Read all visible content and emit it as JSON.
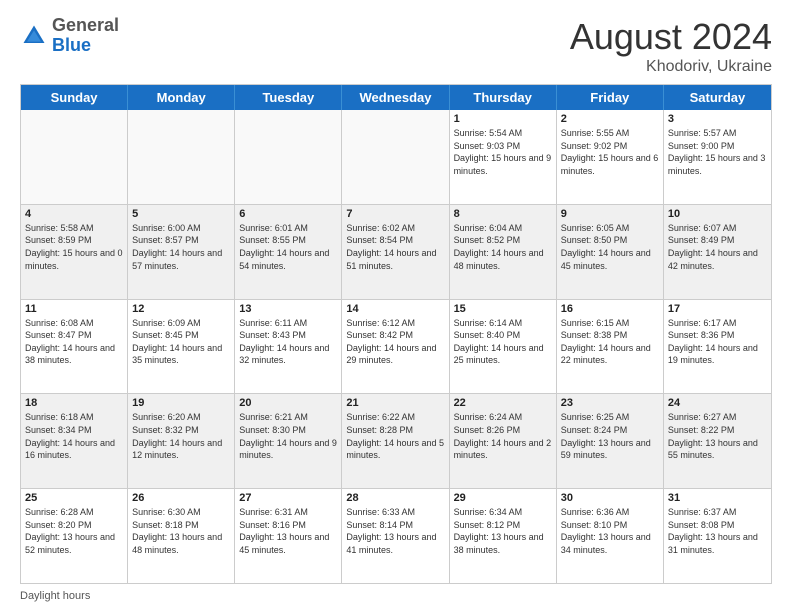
{
  "header": {
    "logo": {
      "general": "General",
      "blue": "Blue"
    },
    "month_year": "August 2024",
    "location": "Khodoriv, Ukraine"
  },
  "day_headers": [
    "Sunday",
    "Monday",
    "Tuesday",
    "Wednesday",
    "Thursday",
    "Friday",
    "Saturday"
  ],
  "weeks": [
    [
      {
        "day": "",
        "empty": true
      },
      {
        "day": "",
        "empty": true
      },
      {
        "day": "",
        "empty": true
      },
      {
        "day": "",
        "empty": true
      },
      {
        "day": "1",
        "info": "Sunrise: 5:54 AM\nSunset: 9:03 PM\nDaylight: 15 hours\nand 9 minutes."
      },
      {
        "day": "2",
        "info": "Sunrise: 5:55 AM\nSunset: 9:02 PM\nDaylight: 15 hours\nand 6 minutes."
      },
      {
        "day": "3",
        "info": "Sunrise: 5:57 AM\nSunset: 9:00 PM\nDaylight: 15 hours\nand 3 minutes."
      }
    ],
    [
      {
        "day": "4",
        "info": "Sunrise: 5:58 AM\nSunset: 8:59 PM\nDaylight: 15 hours\nand 0 minutes."
      },
      {
        "day": "5",
        "info": "Sunrise: 6:00 AM\nSunset: 8:57 PM\nDaylight: 14 hours\nand 57 minutes."
      },
      {
        "day": "6",
        "info": "Sunrise: 6:01 AM\nSunset: 8:55 PM\nDaylight: 14 hours\nand 54 minutes."
      },
      {
        "day": "7",
        "info": "Sunrise: 6:02 AM\nSunset: 8:54 PM\nDaylight: 14 hours\nand 51 minutes."
      },
      {
        "day": "8",
        "info": "Sunrise: 6:04 AM\nSunset: 8:52 PM\nDaylight: 14 hours\nand 48 minutes."
      },
      {
        "day": "9",
        "info": "Sunrise: 6:05 AM\nSunset: 8:50 PM\nDaylight: 14 hours\nand 45 minutes."
      },
      {
        "day": "10",
        "info": "Sunrise: 6:07 AM\nSunset: 8:49 PM\nDaylight: 14 hours\nand 42 minutes."
      }
    ],
    [
      {
        "day": "11",
        "info": "Sunrise: 6:08 AM\nSunset: 8:47 PM\nDaylight: 14 hours\nand 38 minutes."
      },
      {
        "day": "12",
        "info": "Sunrise: 6:09 AM\nSunset: 8:45 PM\nDaylight: 14 hours\nand 35 minutes."
      },
      {
        "day": "13",
        "info": "Sunrise: 6:11 AM\nSunset: 8:43 PM\nDaylight: 14 hours\nand 32 minutes."
      },
      {
        "day": "14",
        "info": "Sunrise: 6:12 AM\nSunset: 8:42 PM\nDaylight: 14 hours\nand 29 minutes."
      },
      {
        "day": "15",
        "info": "Sunrise: 6:14 AM\nSunset: 8:40 PM\nDaylight: 14 hours\nand 25 minutes."
      },
      {
        "day": "16",
        "info": "Sunrise: 6:15 AM\nSunset: 8:38 PM\nDaylight: 14 hours\nand 22 minutes."
      },
      {
        "day": "17",
        "info": "Sunrise: 6:17 AM\nSunset: 8:36 PM\nDaylight: 14 hours\nand 19 minutes."
      }
    ],
    [
      {
        "day": "18",
        "info": "Sunrise: 6:18 AM\nSunset: 8:34 PM\nDaylight: 14 hours\nand 16 minutes."
      },
      {
        "day": "19",
        "info": "Sunrise: 6:20 AM\nSunset: 8:32 PM\nDaylight: 14 hours\nand 12 minutes."
      },
      {
        "day": "20",
        "info": "Sunrise: 6:21 AM\nSunset: 8:30 PM\nDaylight: 14 hours\nand 9 minutes."
      },
      {
        "day": "21",
        "info": "Sunrise: 6:22 AM\nSunset: 8:28 PM\nDaylight: 14 hours\nand 5 minutes."
      },
      {
        "day": "22",
        "info": "Sunrise: 6:24 AM\nSunset: 8:26 PM\nDaylight: 14 hours\nand 2 minutes."
      },
      {
        "day": "23",
        "info": "Sunrise: 6:25 AM\nSunset: 8:24 PM\nDaylight: 13 hours\nand 59 minutes."
      },
      {
        "day": "24",
        "info": "Sunrise: 6:27 AM\nSunset: 8:22 PM\nDaylight: 13 hours\nand 55 minutes."
      }
    ],
    [
      {
        "day": "25",
        "info": "Sunrise: 6:28 AM\nSunset: 8:20 PM\nDaylight: 13 hours\nand 52 minutes."
      },
      {
        "day": "26",
        "info": "Sunrise: 6:30 AM\nSunset: 8:18 PM\nDaylight: 13 hours\nand 48 minutes."
      },
      {
        "day": "27",
        "info": "Sunrise: 6:31 AM\nSunset: 8:16 PM\nDaylight: 13 hours\nand 45 minutes."
      },
      {
        "day": "28",
        "info": "Sunrise: 6:33 AM\nSunset: 8:14 PM\nDaylight: 13 hours\nand 41 minutes."
      },
      {
        "day": "29",
        "info": "Sunrise: 6:34 AM\nSunset: 8:12 PM\nDaylight: 13 hours\nand 38 minutes."
      },
      {
        "day": "30",
        "info": "Sunrise: 6:36 AM\nSunset: 8:10 PM\nDaylight: 13 hours\nand 34 minutes."
      },
      {
        "day": "31",
        "info": "Sunrise: 6:37 AM\nSunset: 8:08 PM\nDaylight: 13 hours\nand 31 minutes."
      }
    ]
  ],
  "footer": {
    "daylight_label": "Daylight hours"
  }
}
